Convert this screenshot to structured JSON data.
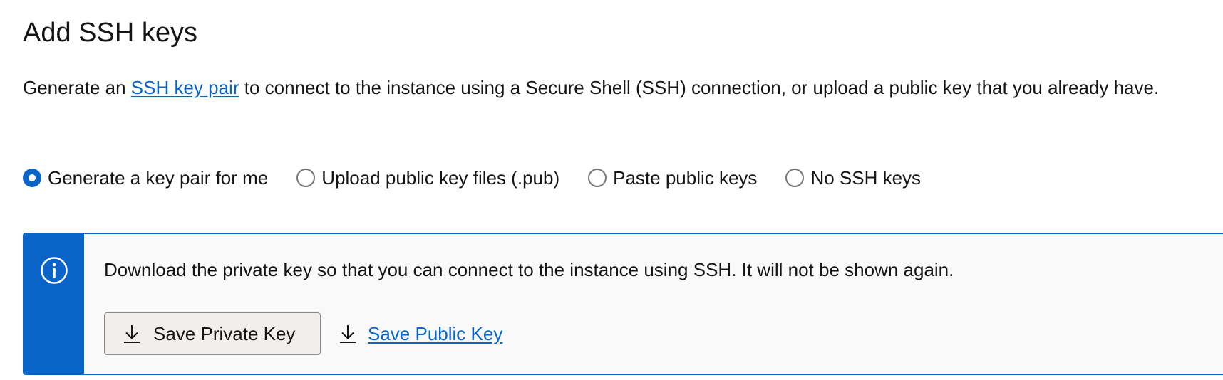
{
  "section": {
    "title": "Add SSH keys",
    "description": {
      "before_link": "Generate an ",
      "link_text": "SSH key pair",
      "after_link": " to connect to the instance using a Secure Shell (SSH) connection, or upload a public key that you already have."
    }
  },
  "key_options": {
    "selected": "Generate a key pair for me",
    "options": [
      {
        "label": "Generate a key pair for me",
        "checked": true
      },
      {
        "label": "Upload public key files (.pub)",
        "checked": false
      },
      {
        "label": "Paste public keys",
        "checked": false
      },
      {
        "label": "No SSH keys",
        "checked": false
      }
    ]
  },
  "banner": {
    "icon": "info-icon",
    "message": "Download the private key so that you can connect to the instance using SSH. It will not be shown again.",
    "save_private_label": "Save Private Key",
    "save_public_label": "Save Public Key",
    "button_icon": "download-icon"
  },
  "colors": {
    "accent": "#0a64c8",
    "text": "#161513",
    "banner_background": "#f8f9f8",
    "button_background": "#f1efed"
  }
}
